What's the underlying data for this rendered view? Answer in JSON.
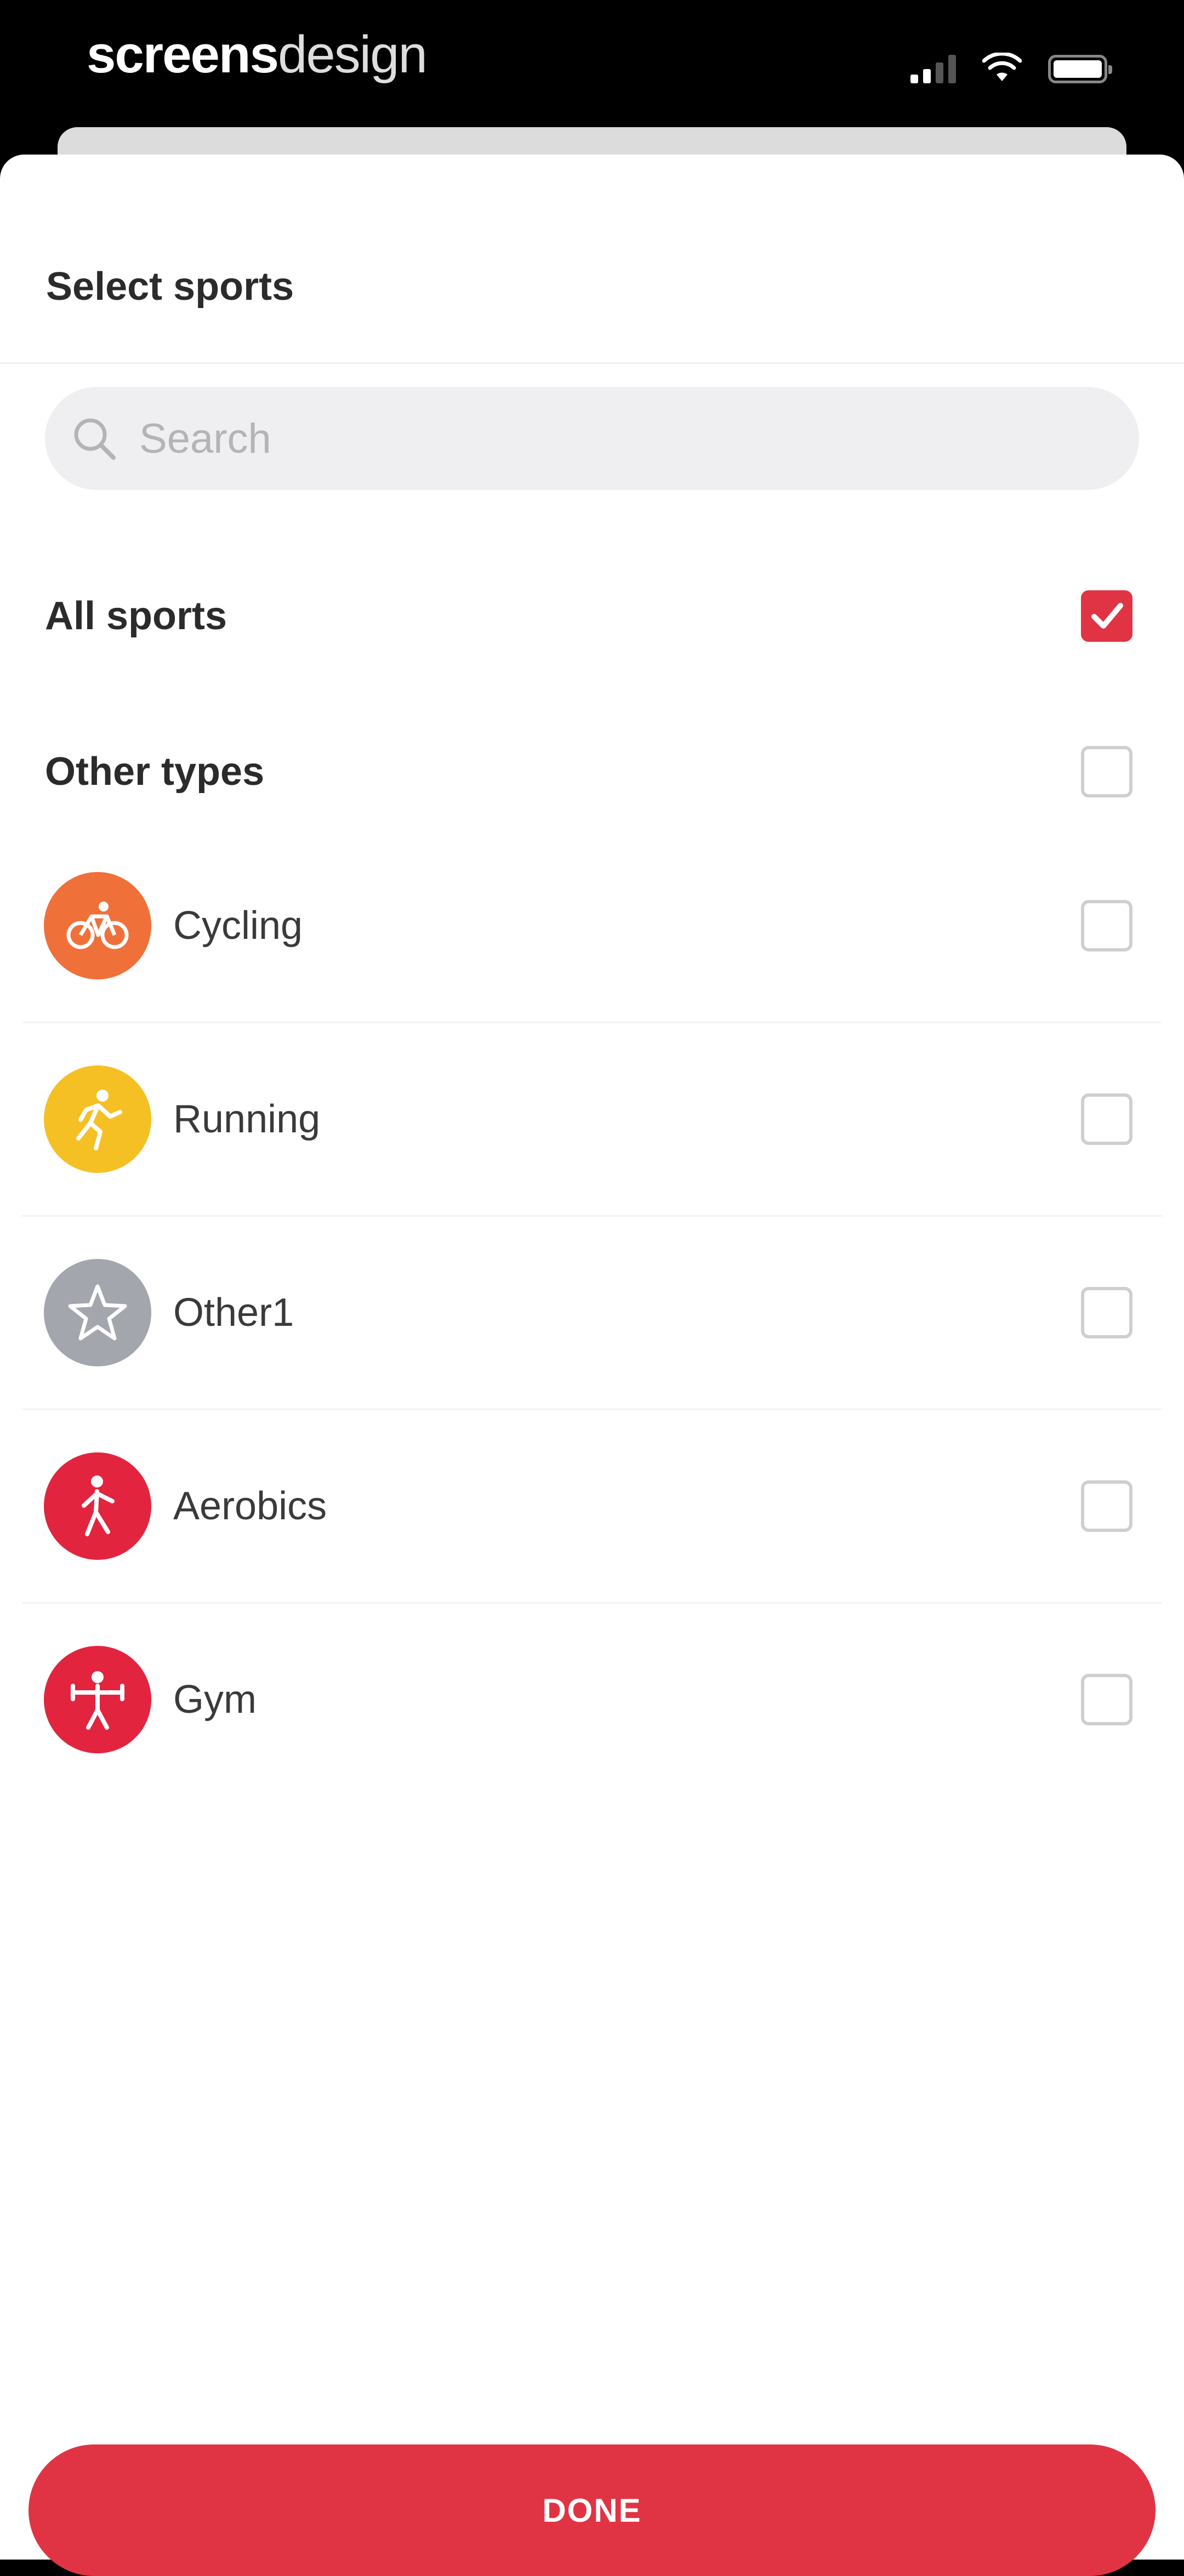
{
  "status_bar": {
    "watermark_bold": "screens",
    "watermark_light": "design"
  },
  "sheet": {
    "title": "Select sports",
    "search": {
      "placeholder": "Search",
      "value": ""
    }
  },
  "options": [
    {
      "label": "All sports",
      "checked": true
    },
    {
      "label": "Other types",
      "checked": false
    }
  ],
  "sports": [
    {
      "label": "Cycling",
      "icon": "bicycle-icon",
      "color": "#f0703a",
      "checked": false
    },
    {
      "label": "Running",
      "icon": "runner-icon",
      "color": "#f5c024",
      "checked": false
    },
    {
      "label": "Other1",
      "icon": "star-icon",
      "color": "#a4a6ad",
      "checked": false
    },
    {
      "label": "Aerobics",
      "icon": "aerobics-icon",
      "color": "#e3243e",
      "checked": false
    },
    {
      "label": "Gym",
      "icon": "gym-icon",
      "color": "#e3243e",
      "checked": false
    }
  ],
  "done_label": "DONE",
  "colors": {
    "accent": "#e03444",
    "sheet": "#ffffff",
    "search_bg": "#efeff1"
  }
}
